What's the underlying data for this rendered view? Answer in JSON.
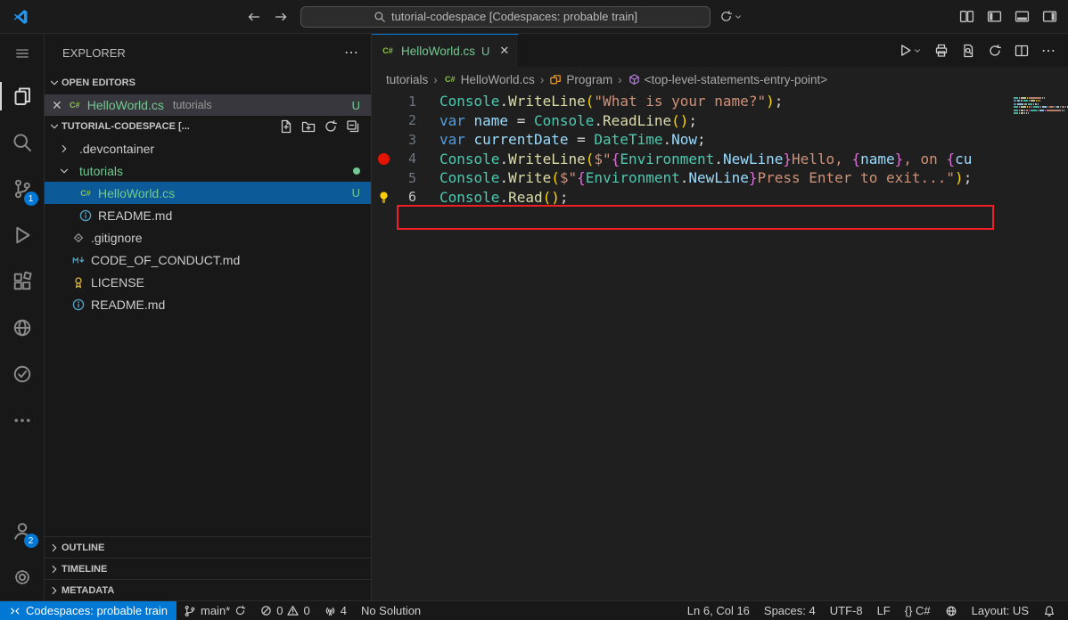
{
  "icons": {
    "close": "✕",
    "more": "⋯",
    "breadcrumb_separator": "›"
  },
  "colors": {
    "accent": "#0078d4",
    "untracked_green": "#73c991",
    "breakpoint_red": "#e51400",
    "annotation_red": "#ed1f24"
  },
  "title_bar": {
    "search_text": "tutorial-codespace [Codespaces: probable train]"
  },
  "activity_bar": {
    "scm_badge": "1",
    "accounts_badge": "2"
  },
  "sidebar": {
    "title": "EXPLORER",
    "sections": {
      "open_editors": "OPEN EDITORS",
      "workspace": "TUTORIAL-CODESPACE [...",
      "outline": "OUTLINE",
      "timeline": "TIMELINE",
      "metadata": "METADATA"
    },
    "open_editor": {
      "name": "HelloWorld.cs",
      "description": "tutorials",
      "badge": "U"
    },
    "tree": [
      {
        "name": ".devcontainer",
        "kind": "folder",
        "expanded": false
      },
      {
        "name": "tutorials",
        "kind": "folder",
        "expanded": true,
        "git_dot": true,
        "color": "green"
      },
      {
        "name": "HelloWorld.cs",
        "kind": "file",
        "icon": "csharp",
        "indent": 1,
        "selected": true,
        "badge": "U",
        "color": "green"
      },
      {
        "name": "README.md",
        "kind": "file",
        "icon": "info",
        "indent": 1
      },
      {
        "name": ".gitignore",
        "kind": "file",
        "icon": "git",
        "indent": 0
      },
      {
        "name": "CODE_OF_CONDUCT.md",
        "kind": "file",
        "icon": "markdown",
        "indent": 0
      },
      {
        "name": "LICENSE",
        "kind": "file",
        "icon": "license",
        "indent": 0
      },
      {
        "name": "README.md",
        "kind": "file",
        "icon": "info",
        "indent": 0
      }
    ]
  },
  "editor": {
    "tab": {
      "name": "HelloWorld.cs",
      "badge": "U"
    },
    "breadcrumbs": [
      "tutorials",
      "HelloWorld.cs",
      "Program",
      "<top-level-statements-entry-point>"
    ],
    "code_lines": [
      {
        "num": "1",
        "tokens": [
          [
            "Console",
            "cls"
          ],
          [
            ".",
            "pl"
          ],
          [
            "WriteLine",
            "fn"
          ],
          [
            "(",
            "br1"
          ],
          [
            "\"What is your name?\"",
            "str"
          ],
          [
            ")",
            "br1"
          ],
          [
            ";",
            "pl"
          ]
        ]
      },
      {
        "num": "2",
        "tokens": [
          [
            "var ",
            "kw"
          ],
          [
            "name",
            "var"
          ],
          [
            " = ",
            "pl"
          ],
          [
            "Console",
            "cls"
          ],
          [
            ".",
            "pl"
          ],
          [
            "ReadLine",
            "fn"
          ],
          [
            "(",
            "br1"
          ],
          [
            ")",
            "br1"
          ],
          [
            ";",
            "pl"
          ]
        ]
      },
      {
        "num": "3",
        "tokens": [
          [
            "var ",
            "kw"
          ],
          [
            "currentDate",
            "var"
          ],
          [
            " = ",
            "pl"
          ],
          [
            "DateTime",
            "cls"
          ],
          [
            ".",
            "pl"
          ],
          [
            "Now",
            "var"
          ],
          [
            ";",
            "pl"
          ]
        ]
      },
      {
        "num": "4",
        "breakpoint": true,
        "annotated": true,
        "tokens": [
          [
            "Console",
            "cls"
          ],
          [
            ".",
            "pl"
          ],
          [
            "WriteLine",
            "fn"
          ],
          [
            "(",
            "br1"
          ],
          [
            "$\"",
            "str"
          ],
          [
            "{",
            "br2"
          ],
          [
            "Environment",
            "cls"
          ],
          [
            ".",
            "pl"
          ],
          [
            "NewLine",
            "var"
          ],
          [
            "}",
            "br2"
          ],
          [
            "Hello, ",
            "str"
          ],
          [
            "{",
            "br2"
          ],
          [
            "name",
            "var"
          ],
          [
            "}",
            "br2"
          ],
          [
            ", on ",
            "str"
          ],
          [
            "{",
            "br2"
          ],
          [
            "cu",
            "var"
          ]
        ]
      },
      {
        "num": "5",
        "tokens": [
          [
            "Console",
            "cls"
          ],
          [
            ".",
            "pl"
          ],
          [
            "Write",
            "fn"
          ],
          [
            "(",
            "br1"
          ],
          [
            "$\"",
            "str"
          ],
          [
            "{",
            "br2"
          ],
          [
            "Environment",
            "cls"
          ],
          [
            ".",
            "pl"
          ],
          [
            "NewLine",
            "var"
          ],
          [
            "}",
            "br2"
          ],
          [
            "Press Enter to exit...\"",
            "str"
          ],
          [
            ")",
            "br1"
          ],
          [
            ";",
            "pl"
          ]
        ]
      },
      {
        "num": "6",
        "lightbulb": true,
        "active": true,
        "tokens": [
          [
            "Console",
            "cls"
          ],
          [
            ".",
            "pl"
          ],
          [
            "Read",
            "fn"
          ],
          [
            "(",
            "br1"
          ],
          [
            ")",
            "br1"
          ],
          [
            ";",
            "pl"
          ]
        ]
      }
    ]
  },
  "status_bar": {
    "remote": "Codespaces: probable train",
    "branch": "main*",
    "errors": "0",
    "warnings": "0",
    "ports": "4",
    "solution": "No Solution",
    "cursor": "Ln 6, Col 16",
    "indent": "Spaces: 4",
    "encoding": "UTF-8",
    "eol": "LF",
    "language": "{} C#",
    "layout": "Layout: US"
  }
}
